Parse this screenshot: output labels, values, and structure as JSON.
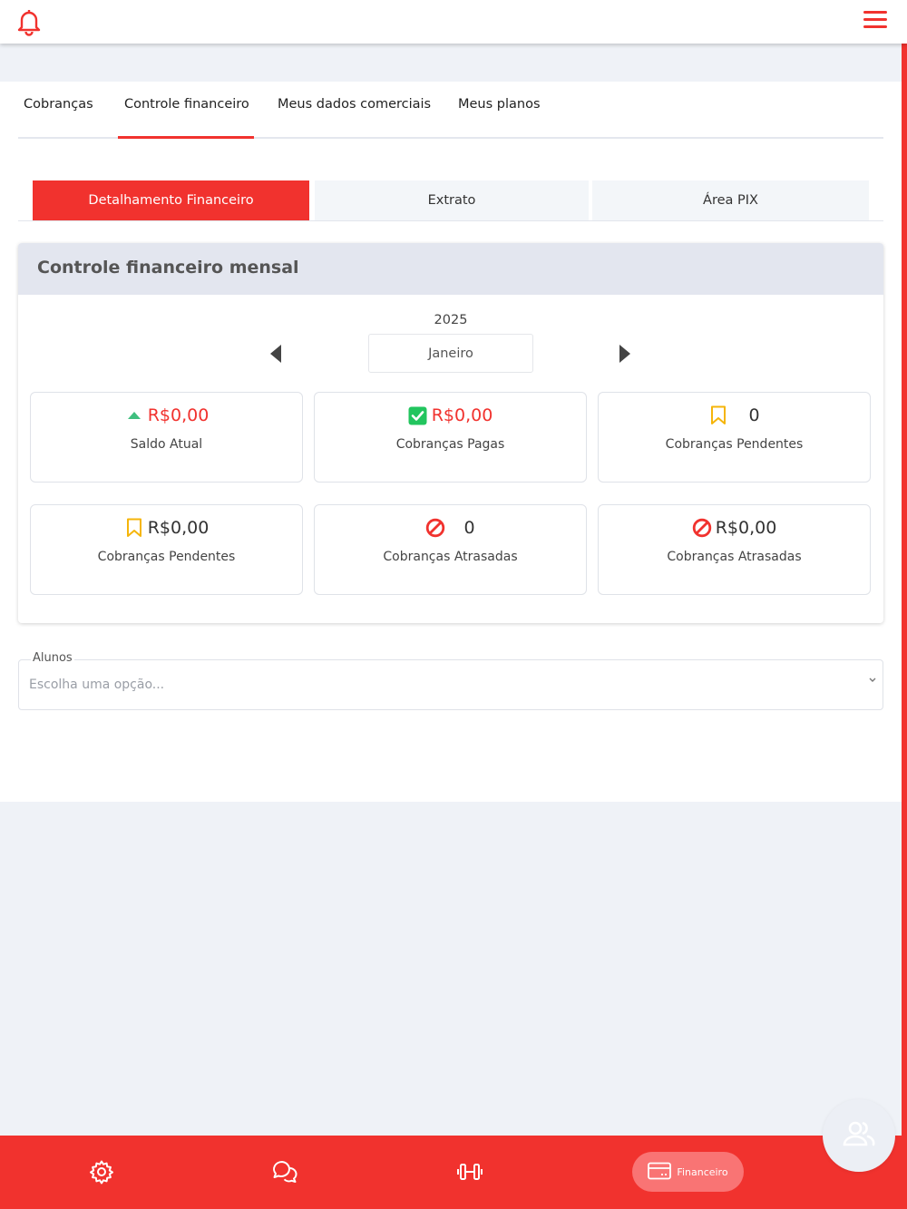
{
  "topbar": {
    "bell_icon": "bell-icon",
    "menu_icon": "hamburger-menu-icon"
  },
  "tabs": [
    {
      "label": "Cobranças"
    },
    {
      "label": "Controle financeiro",
      "active": true
    },
    {
      "label": "Meus dados comerciais"
    },
    {
      "label": "Meus planos"
    }
  ],
  "subtabs": [
    {
      "label": "Detalhamento Financeiro",
      "active": true
    },
    {
      "label": "Extrato"
    },
    {
      "label": "Área PIX"
    }
  ],
  "card": {
    "title": "Controle financeiro mensal",
    "year": "2025",
    "month": "Janeiro"
  },
  "stats": [
    {
      "value": "R$0,00",
      "label": "Saldo Atual",
      "icon": "triangle-up-icon"
    },
    {
      "value": "R$0,00",
      "label": "Cobranças Pagas",
      "icon": "checkbox-check-icon"
    },
    {
      "value": "0",
      "label": "Cobranças Pendentes",
      "icon": "bookmark-icon"
    },
    {
      "value": "R$0,00",
      "label": "Cobranças Pendentes",
      "icon": "bookmark-icon"
    },
    {
      "value": "0",
      "label": "Cobranças Atrasadas",
      "icon": "prohibited-icon"
    },
    {
      "value": "R$0,00",
      "label": "Cobranças Atrasadas",
      "icon": "prohibited-icon"
    }
  ],
  "alunos": {
    "label": "Alunos",
    "placeholder": "Escolha uma opção..."
  },
  "bottomnav": {
    "items": [
      "gear-icon",
      "chat-icon",
      "dumbbell-icon"
    ],
    "active_label": "Financeiro",
    "active_icon": "credit-card-icon"
  },
  "fab_icon": "users-icon",
  "colors": {
    "accent": "#f1322e",
    "success": "#22c55e",
    "warning": "#f5b50a",
    "up": "#3fbf7f"
  }
}
